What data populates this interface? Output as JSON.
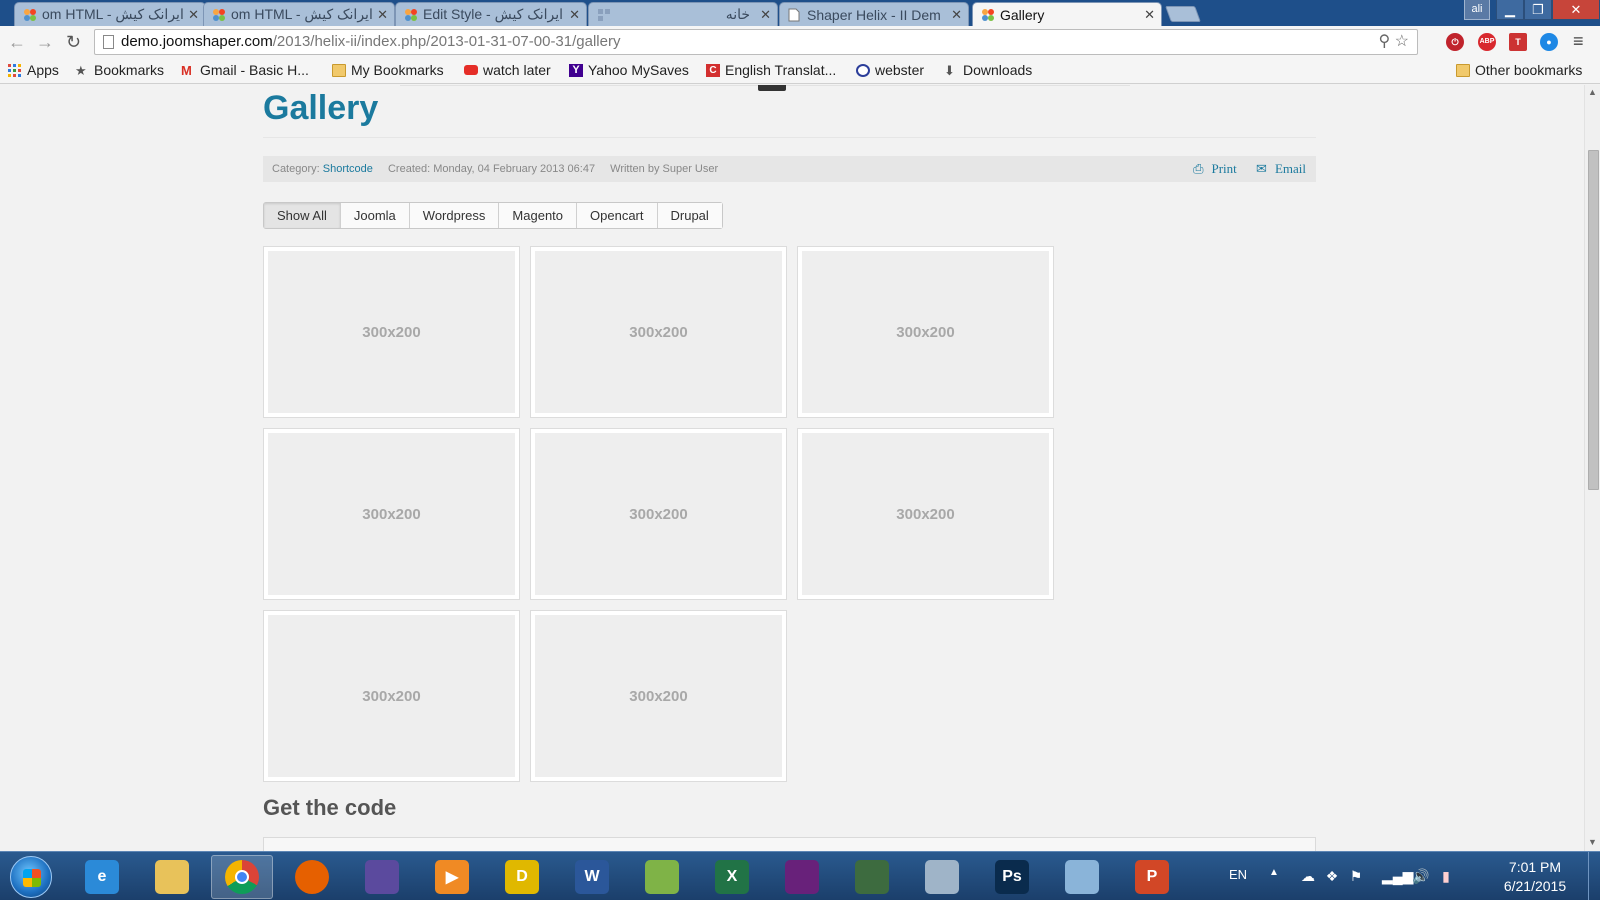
{
  "browser": {
    "tabs": [
      {
        "title": "om HTML - ایرانک کیش",
        "active": false
      },
      {
        "title": "om HTML - ایرانک کیش",
        "active": false
      },
      {
        "title": "Edit Style - ایرانک کیش",
        "active": false
      },
      {
        "title": "خانه",
        "active": false
      },
      {
        "title": "Shaper Helix - II Dem",
        "active": false
      },
      {
        "title": "Gallery",
        "active": true
      }
    ],
    "user_badge": "ali",
    "url_host": "demo.joomshaper.com",
    "url_path": "/2013/helix-ii/index.php/2013-01-31-07-00-31/gallery",
    "bookmarks": [
      {
        "label": "Apps",
        "icon": "apps-grid-icon"
      },
      {
        "label": "Bookmarks",
        "icon": "star-icon"
      },
      {
        "label": "Gmail - Basic H...",
        "icon": "gmail-icon"
      },
      {
        "label": "My Bookmarks",
        "icon": "folder-icon"
      },
      {
        "label": "watch later",
        "icon": "youtube-icon"
      },
      {
        "label": "Yahoo MySaves",
        "icon": "yahoo-icon"
      },
      {
        "label": "English Translat...",
        "icon": "translate-icon"
      },
      {
        "label": "webster",
        "icon": "webster-icon"
      },
      {
        "label": "Downloads",
        "icon": "download-icon"
      }
    ],
    "other_bookmarks": "Other bookmarks"
  },
  "article": {
    "title": "Gallery",
    "meta": {
      "category_label": "Category:",
      "category_value": "Shortcode",
      "created": "Created: Monday, 04 February 2013 06:47",
      "author": "Written by Super User",
      "print": "Print",
      "email": "Email"
    },
    "filters": [
      {
        "label": "Show All",
        "active": true
      },
      {
        "label": "Joomla",
        "active": false
      },
      {
        "label": "Wordpress",
        "active": false
      },
      {
        "label": "Magento",
        "active": false
      },
      {
        "label": "Opencart",
        "active": false
      },
      {
        "label": "Drupal",
        "active": false
      }
    ],
    "gallery_items": [
      "300x200",
      "300x200",
      "300x200",
      "300x200",
      "300x200",
      "300x200",
      "300x200",
      "300x200"
    ],
    "subheading": "Get the code"
  },
  "taskbar": {
    "apps": [
      {
        "name": "internet-explorer-icon",
        "glyph": "e",
        "color": "#2b8ad8"
      },
      {
        "name": "file-explorer-icon",
        "glyph": "",
        "color": "#e8c25a"
      },
      {
        "name": "chrome-icon",
        "glyph": "",
        "color": "#db4437"
      },
      {
        "name": "firefox-icon",
        "glyph": "",
        "color": "#e66000"
      },
      {
        "name": "castle-app-icon",
        "glyph": "",
        "color": "#5b4a9e"
      },
      {
        "name": "media-player-icon",
        "glyph": "▶",
        "color": "#f08a24"
      },
      {
        "name": "duden-icon",
        "glyph": "D",
        "color": "#e0b800"
      },
      {
        "name": "word-icon",
        "glyph": "W",
        "color": "#2b579a"
      },
      {
        "name": "notepad-icon",
        "glyph": "",
        "color": "#7fb347"
      },
      {
        "name": "excel-icon",
        "glyph": "X",
        "color": "#217346"
      },
      {
        "name": "visual-studio-icon",
        "glyph": "",
        "color": "#68217a"
      },
      {
        "name": "monitor-app-icon",
        "glyph": "",
        "color": "#3d6b3f"
      },
      {
        "name": "wifi-app-icon",
        "glyph": "",
        "color": "#9fb4c8"
      },
      {
        "name": "photoshop-icon",
        "glyph": "Ps",
        "color": "#0a2b4d"
      },
      {
        "name": "remote-desktop-icon",
        "glyph": "",
        "color": "#8ab4d9"
      },
      {
        "name": "powerpoint-icon",
        "glyph": "P",
        "color": "#d24726"
      }
    ],
    "language": "EN",
    "time": "7:01 PM",
    "date": "6/21/2015"
  }
}
